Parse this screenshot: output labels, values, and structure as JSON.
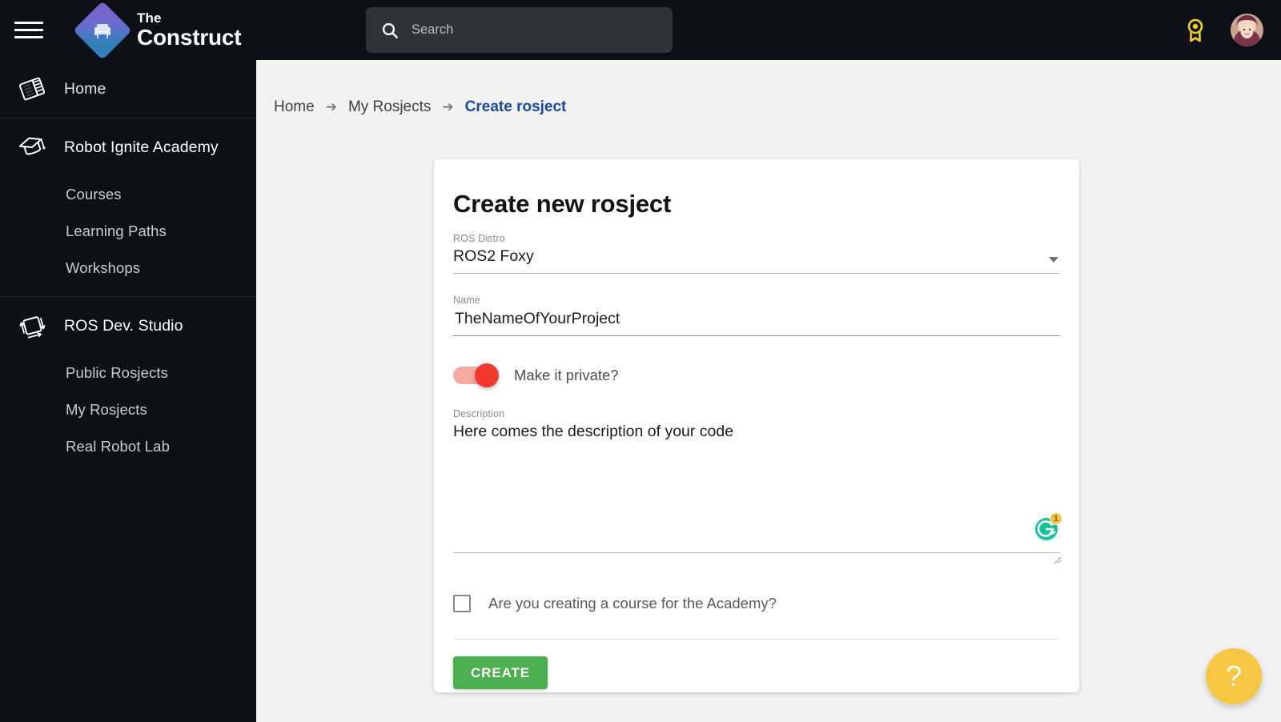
{
  "topbar": {
    "menu_icon": "hamburger-menu-icon",
    "logo_icon": "the-construct-logo-icon",
    "brand_line1": "The",
    "brand_line2": "Construct",
    "search_placeholder": "Search",
    "search_value": "",
    "search_icon": "search-icon",
    "award_icon": "award-ribbon-icon",
    "avatar_icon": "user-avatar"
  },
  "sidebar": {
    "home": {
      "label": "Home",
      "icon": "home-book-icon"
    },
    "academy": {
      "label": "Robot Ignite Academy",
      "icon": "graduation-cap-icon"
    },
    "academy_items": [
      {
        "label": "Courses"
      },
      {
        "label": "Learning Paths"
      },
      {
        "label": "Workshops"
      }
    ],
    "studio": {
      "label": "ROS Dev. Studio",
      "icon": "rotated-square-arrows-icon"
    },
    "studio_items": [
      {
        "label": "Public Rosjects"
      },
      {
        "label": "My Rosjects"
      },
      {
        "label": "Real Robot Lab"
      }
    ]
  },
  "breadcrumb": {
    "items": [
      {
        "label": "Home",
        "current": false
      },
      {
        "label": "My Rosjects",
        "current": false
      },
      {
        "label": "Create rosject",
        "current": true
      }
    ],
    "separator": "➔"
  },
  "card": {
    "title": "Create new rosject",
    "ros_distro": {
      "label": "ROS Distro",
      "value": "ROS2 Foxy",
      "caret_icon": "chevron-down-icon"
    },
    "name": {
      "label": "Name",
      "value": "TheNameOfYourProject",
      "placeholder": "TheNameOfYourProject"
    },
    "private_toggle": {
      "label": "Make it private?",
      "state": "on"
    },
    "description": {
      "label": "Description",
      "value": "Here comes the description of your code",
      "placeholder": "Here comes the description of your code"
    },
    "grammarly": {
      "icon": "grammarly-icon",
      "badge": "1"
    },
    "academy_checkbox": {
      "label": "Are you creating a course for the Academy?",
      "checked": false
    },
    "create_button": "CREATE"
  },
  "help_fab": {
    "label": "?",
    "icon": "question-mark-icon"
  },
  "colors": {
    "topbar_bg": "#0d1117",
    "sidebar_bg": "#0d1117",
    "content_bg": "#f2f2f2",
    "breadcrumb_active": "#1849a3",
    "toggle_on": "#f2392c",
    "create_button": "#4caf50",
    "help_fab": "#f7c744",
    "award": "#f2d024",
    "grammarly_green": "#15c39a"
  }
}
